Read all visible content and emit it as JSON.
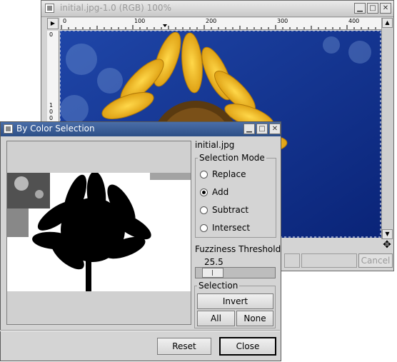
{
  "image_window": {
    "title": "initial.jpg-1.0 (RGB) 100%",
    "ruler_h_ticks": [
      "0",
      "100",
      "200",
      "300",
      "400"
    ],
    "ruler_v_ticks": [
      "0",
      "1",
      "0",
      "0"
    ],
    "cancel_label": "Cancel",
    "min_label": "▁",
    "max_label": "□",
    "close_label": "✕"
  },
  "dialog": {
    "title": "By Color Selection",
    "image_name": "initial.jpg",
    "selection_mode": {
      "legend": "Selection Mode",
      "options": [
        "Replace",
        "Add",
        "Subtract",
        "Intersect"
      ],
      "selected": "Add"
    },
    "fuzziness": {
      "label": "Fuzziness Threshold",
      "value": "25.5",
      "fraction": 0.1
    },
    "selection": {
      "legend": "Selection",
      "invert_label": "Invert",
      "all_label": "All",
      "none_label": "None"
    },
    "reset_label": "Reset",
    "close_label": "Close",
    "min_label": "▁",
    "max_label": "□",
    "close_x": "✕"
  },
  "colors": {
    "sky": "#0b2a8a",
    "petal": "#f2c019",
    "titlebar_active": "#2d4f87"
  }
}
